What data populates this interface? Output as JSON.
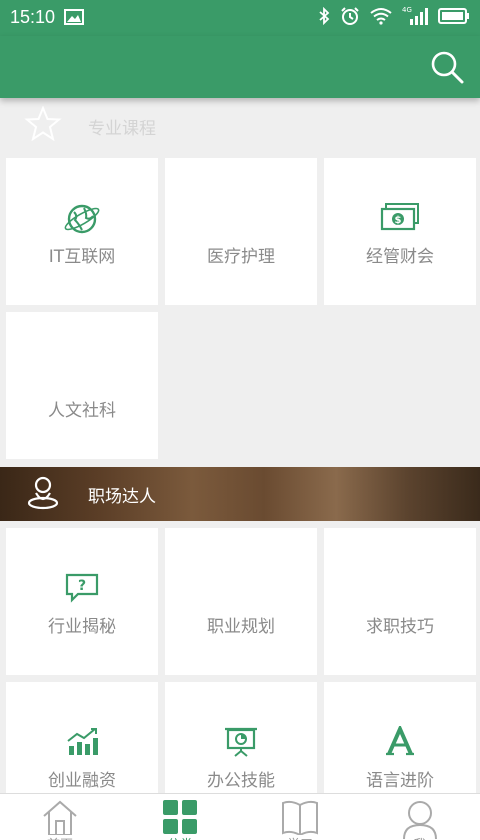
{
  "status": {
    "time": "15:10",
    "network": "4G"
  },
  "colors": {
    "brand": "#3a9b68",
    "tile_text": "#8a8a8a"
  },
  "sections": {
    "courses": {
      "title": "专业课程"
    },
    "career": {
      "title": "职场达人"
    }
  },
  "courses": [
    {
      "label": "IT互联网",
      "icon": "globe-icon"
    },
    {
      "label": "医疗护理",
      "icon": ""
    },
    {
      "label": "经管财会",
      "icon": "money-icon"
    },
    {
      "label": "人文社科",
      "icon": ""
    }
  ],
  "career": [
    {
      "label": "行业揭秘",
      "icon": "question-bubble-icon"
    },
    {
      "label": "职业规划",
      "icon": ""
    },
    {
      "label": "求职技巧",
      "icon": ""
    },
    {
      "label": "创业融资",
      "icon": "bar-chart-icon"
    },
    {
      "label": "办公技能",
      "icon": "presentation-icon"
    },
    {
      "label": "语言进阶",
      "icon": "letter-a-icon"
    }
  ],
  "nav": [
    {
      "label": "首页",
      "icon": "home-icon"
    },
    {
      "label": "分类",
      "icon": "grid-icon",
      "active": true
    },
    {
      "label": "学习",
      "icon": "book-icon"
    },
    {
      "label": "我",
      "icon": "person-icon"
    }
  ]
}
